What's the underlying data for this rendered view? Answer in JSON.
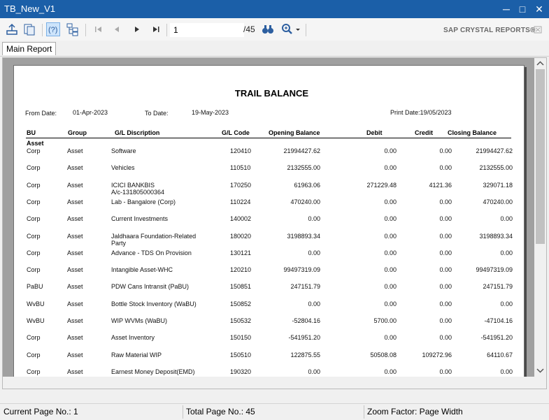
{
  "window": {
    "title": "TB_New_V1",
    "minimize": "─",
    "maximize": "□",
    "close": "✕"
  },
  "toolbar": {
    "page_value": "1",
    "total_pages_label": "/45",
    "sap_logo": "SAP CRYSTAL REPORTS®",
    "icons": [
      "export-icon",
      "print-icon",
      "help-icon",
      "tree-icon",
      "first-page-icon",
      "prev-page-icon",
      "next-page-icon",
      "last-page-icon",
      "binoculars-icon",
      "zoom-icon",
      "close-report-icon"
    ]
  },
  "tab": {
    "label": "Main Report"
  },
  "report": {
    "title": "TRAIL BALANCE",
    "from_date_label": "From Date:",
    "from_date_value": "01-Apr-2023",
    "to_date_label": "To Date:",
    "to_date_value": "19-May-2023",
    "print_date_label": "Print Date:19/05/2023",
    "columns": [
      "BU",
      "Group",
      "G/L Discription",
      "G/L Code",
      "Opening Balance",
      "Debit",
      "Credit",
      "Closing Balance"
    ],
    "group_label": "Asset",
    "rows": [
      {
        "bu": "Corp",
        "group": "Asset",
        "desc": "Software",
        "desc2": "",
        "code": "120410",
        "opening": "21994427.62",
        "debit": "0.00",
        "credit": "0.00",
        "closing": "21994427.62"
      },
      {
        "bu": "Corp",
        "group": "Asset",
        "desc": "Vehicles",
        "desc2": "",
        "code": "110510",
        "opening": "2132555.00",
        "debit": "0.00",
        "credit": "0.00",
        "closing": "2132555.00"
      },
      {
        "bu": "Corp",
        "group": "Asset",
        "desc": "ICICI BANKBIS",
        "desc2": "A/c-131805000364",
        "code": "170250",
        "opening": "61963.06",
        "debit": "271229.48",
        "credit": "4121.36",
        "closing": "329071.18"
      },
      {
        "bu": "Corp",
        "group": "Asset",
        "desc": "Lab - Bangalore (Corp)",
        "desc2": "",
        "code": "110224",
        "opening": "470240.00",
        "debit": "0.00",
        "credit": "0.00",
        "closing": "470240.00"
      },
      {
        "bu": "Corp",
        "group": "Asset",
        "desc": "Current Investments",
        "desc2": "",
        "code": "140002",
        "opening": "0.00",
        "debit": "0.00",
        "credit": "0.00",
        "closing": "0.00"
      },
      {
        "bu": "Corp",
        "group": "Asset",
        "desc": "Jaldhaara Foundation-Related",
        "desc2": "Party",
        "code": "180020",
        "opening": "3198893.34",
        "debit": "0.00",
        "credit": "0.00",
        "closing": "3198893.34"
      },
      {
        "bu": "Corp",
        "group": "Asset",
        "desc": "Advance - TDS On Provision",
        "desc2": "",
        "code": "130121",
        "opening": "0.00",
        "debit": "0.00",
        "credit": "0.00",
        "closing": "0.00"
      },
      {
        "bu": "Corp",
        "group": "Asset",
        "desc": "Intangible Asset-WHC",
        "desc2": "",
        "code": "120210",
        "opening": "99497319.09",
        "debit": "0.00",
        "credit": "0.00",
        "closing": "99497319.09"
      },
      {
        "bu": "PaBU",
        "group": "Asset",
        "desc": "PDW Cans Intransit (PaBU)",
        "desc2": "",
        "code": "150851",
        "opening": "247151.79",
        "debit": "0.00",
        "credit": "0.00",
        "closing": "247151.79"
      },
      {
        "bu": "WvBU",
        "group": "Asset",
        "desc": "Bottle Stock Inventory (WaBU)",
        "desc2": "",
        "code": "150852",
        "opening": "0.00",
        "debit": "0.00",
        "credit": "0.00",
        "closing": "0.00"
      },
      {
        "bu": "WvBU",
        "group": "Asset",
        "desc": "WIP WVMs (WaBU)",
        "desc2": "",
        "code": "150532",
        "opening": "-52804.16",
        "debit": "5700.00",
        "credit": "0.00",
        "closing": "-47104.16"
      },
      {
        "bu": "Corp",
        "group": "Asset",
        "desc": "Asset Inventory",
        "desc2": "",
        "code": "150150",
        "opening": "-541951.20",
        "debit": "0.00",
        "credit": "0.00",
        "closing": "-541951.20"
      },
      {
        "bu": "Corp",
        "group": "Asset",
        "desc": "Raw Material WIP",
        "desc2": "",
        "code": "150510",
        "opening": "122875.55",
        "debit": "50508.08",
        "credit": "109272.96",
        "closing": "64110.67"
      },
      {
        "bu": "Corp",
        "group": "Asset",
        "desc": "Earnest Money Deposit(EMD)",
        "desc2": "",
        "code": "190320",
        "opening": "0.00",
        "debit": "0.00",
        "credit": "0.00",
        "closing": "0.00"
      }
    ]
  },
  "status": {
    "current_page": "Current Page No.: 1",
    "total_pages": "Total Page No.: 45",
    "zoom": "Zoom Factor: Page Width"
  }
}
